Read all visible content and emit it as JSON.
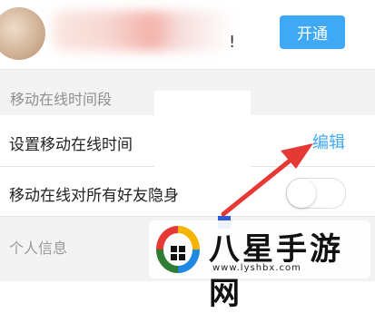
{
  "header": {
    "name_suffix": "!",
    "open_button_label": "开通"
  },
  "sections": {
    "mobile_online_title": "移动在线时间段",
    "personal_info_title": "个人信息"
  },
  "rows": {
    "set_time_label": "设置移动在线时间",
    "edit_label": "编辑",
    "invisible_label": "移动在线对所有好友隐身",
    "invisible_toggle_on": false
  },
  "watermark": {
    "title": "八星手游网",
    "url": "www.lyshbx.com"
  },
  "colors": {
    "accent": "#3fa9f5",
    "arrow": "#e53935"
  }
}
